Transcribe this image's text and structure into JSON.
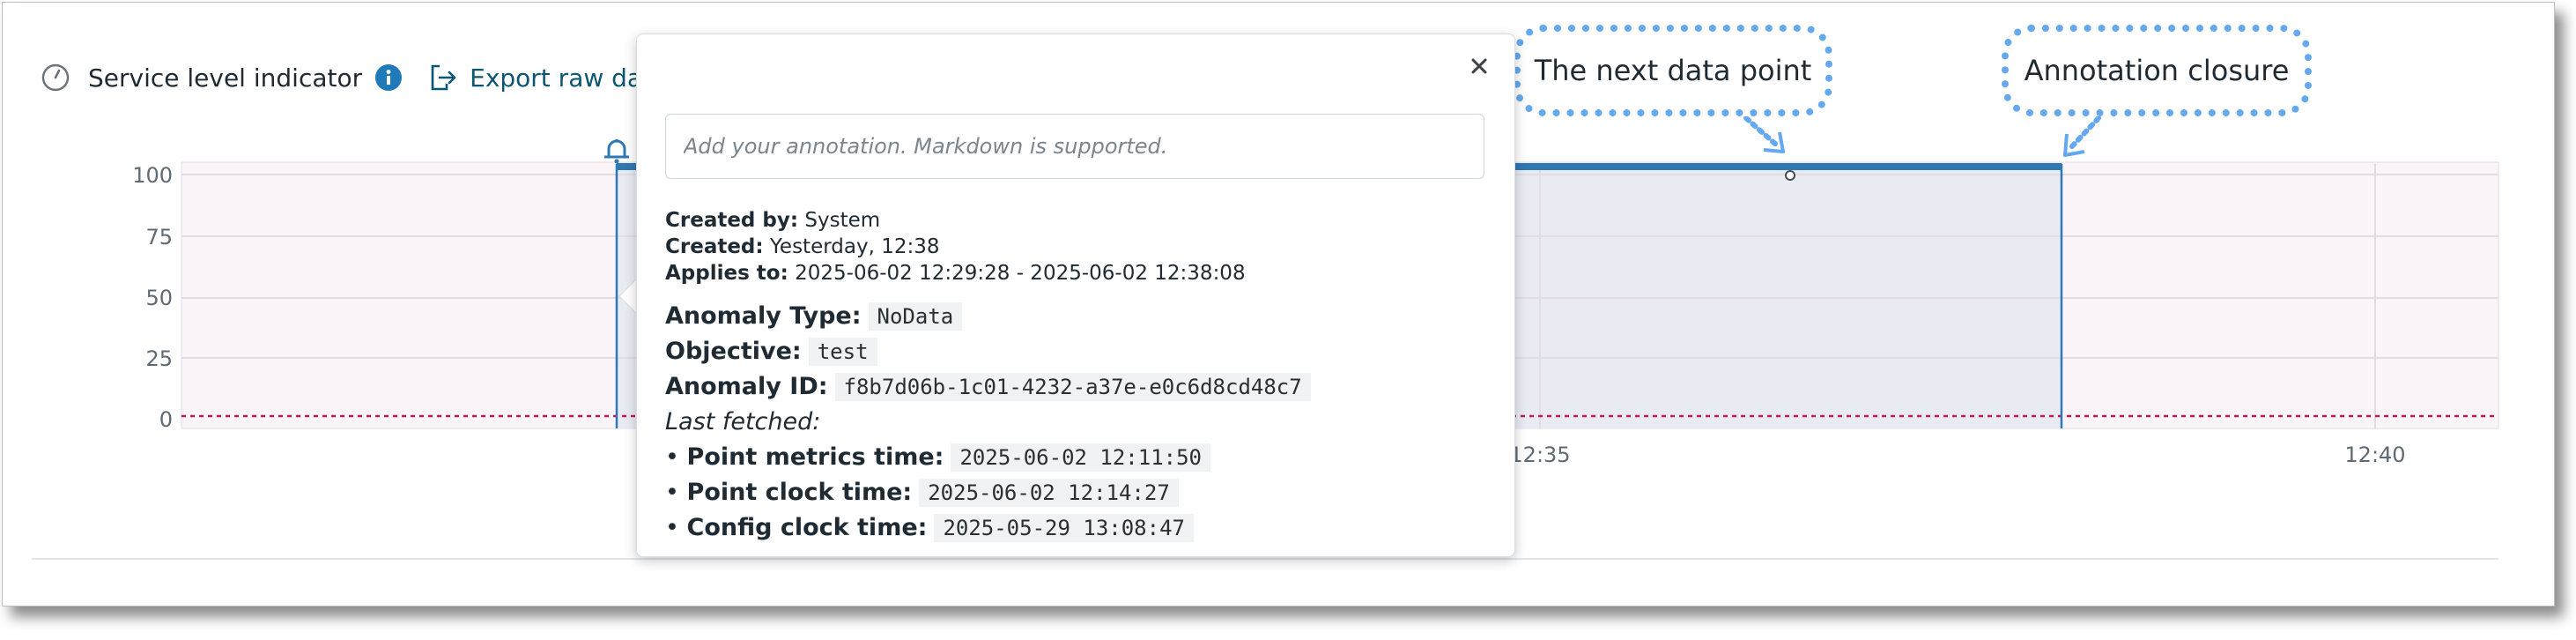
{
  "header": {
    "title": "Service level indicator",
    "export_label": "Export raw data"
  },
  "colors": {
    "accent": "#2f78b4",
    "annotation_fill": "#e9ebf3",
    "threshold": "#c2185b",
    "callout_border": "#64a8f0",
    "plot_bg": "#fbf4f8"
  },
  "chart_data": {
    "type": "line",
    "ylim": [
      0,
      100
    ],
    "y_ticks": [
      "100",
      "75",
      "50",
      "25",
      "0"
    ],
    "x_ticks": [
      "12:35",
      "12:40"
    ],
    "threshold": 0,
    "series": [
      {
        "values": [
          100,
          100
        ]
      }
    ]
  },
  "annotation_popup": {
    "input_placeholder": "Add your annotation. Markdown is supported.",
    "close_icon": "close-icon",
    "created_by_label": "Created by:",
    "created_by": "System",
    "created_label": "Created:",
    "created": "Yesterday, 12:38",
    "applies_to_label": "Applies to:",
    "applies_to": "2025-06-02 12:29:28 - 2025-06-02 12:38:08",
    "anomaly_type_label": "Anomaly Type:",
    "anomaly_type": "NoData",
    "objective_label": "Objective:",
    "objective": "test",
    "anomaly_id_label": "Anomaly ID:",
    "anomaly_id": "f8b7d06b-1c01-4232-a37e-e0c6d8cd48c7",
    "last_fetched_label": "Last fetched:",
    "bullet": "•",
    "point_metrics_label": "Point metrics time:",
    "point_metrics": "2025-06-02 12:11:50",
    "point_clock_label": "Point clock time:",
    "point_clock": "2025-06-02 12:14:27",
    "config_clock_label": "Config clock time:",
    "config_clock": "2025-05-29 13:08:47"
  },
  "callouts": {
    "next_point": "The next data point",
    "closure": "Annotation closure"
  }
}
